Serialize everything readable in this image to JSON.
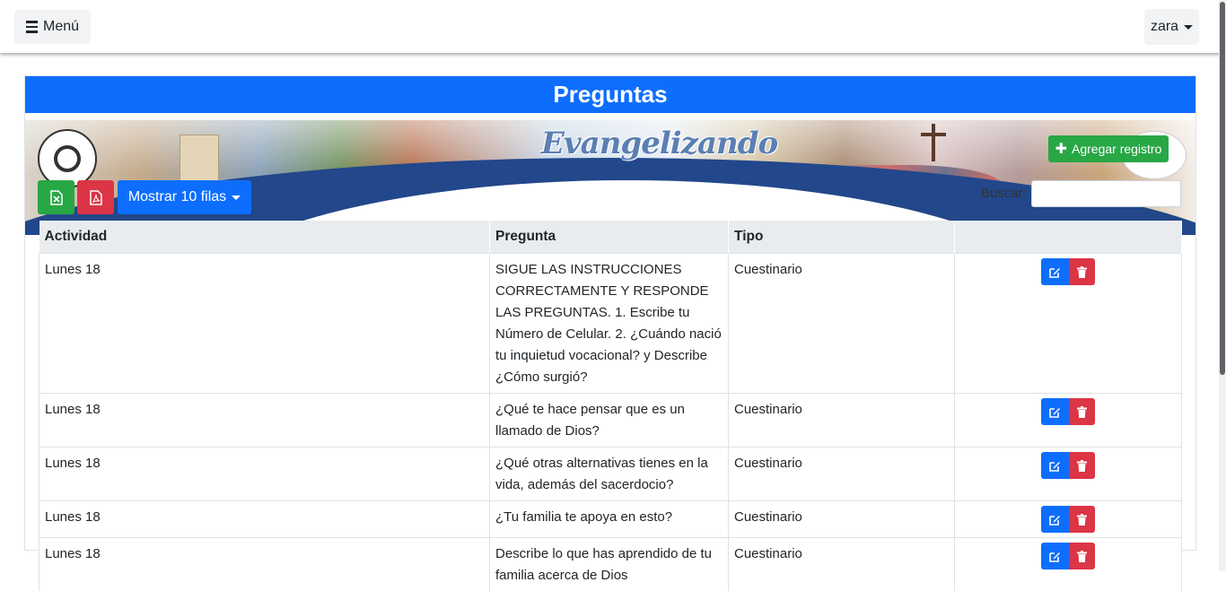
{
  "navbar": {
    "menu_label": "Menú",
    "user_label": "zara"
  },
  "page": {
    "title": "Preguntas"
  },
  "banner": {
    "brand_text": "Evangelizando"
  },
  "toolbar": {
    "add_label": "Agregar registro",
    "rows_label": "Mostrar 10 filas",
    "search_label": "Buscar:",
    "search_value": ""
  },
  "table": {
    "headers": [
      "Actividad",
      "Pregunta",
      "Tipo",
      ""
    ],
    "rows": [
      {
        "actividad": "Lunes 18",
        "pregunta": "SIGUE LAS INSTRUCCIONES CORRECTAMENTE Y RESPONDE LAS PREGUNTAS. 1. Escribe tu Número de Celular. 2. ¿Cuándo nació tu inquietud vocacional? y Describe ¿Cómo surgió?",
        "tipo": "Cuestinario"
      },
      {
        "actividad": "Lunes 18",
        "pregunta": "¿Qué te hace pensar que es un llamado de Dios?",
        "tipo": "Cuestinario"
      },
      {
        "actividad": "Lunes 18",
        "pregunta": "¿Qué otras alternativas tienes en la vida, además del sacerdocio?",
        "tipo": "Cuestinario"
      },
      {
        "actividad": "Lunes 18",
        "pregunta": "¿Tu familia te apoya en esto?",
        "tipo": "Cuestinario"
      },
      {
        "actividad": "Lunes 18",
        "pregunta": "Describe lo que has aprendido de tu familia acerca de Dios",
        "tipo": "Cuestinario"
      }
    ]
  },
  "colors": {
    "primary": "#0d6efd",
    "success": "#28a745",
    "danger": "#dc3545",
    "banner_wave": "#22478a"
  }
}
